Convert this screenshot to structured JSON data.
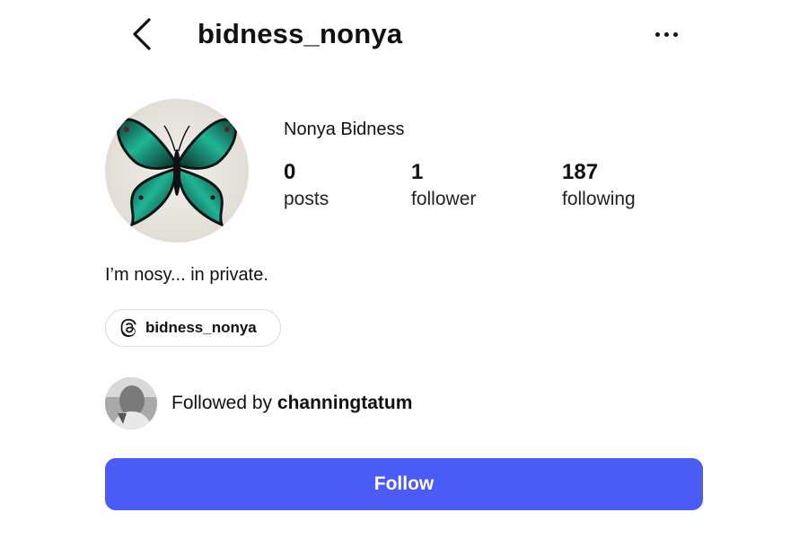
{
  "header": {
    "username": "bidness_nonya",
    "back_icon": "chevron-left-icon",
    "more_icon": "more-horizontal-icon"
  },
  "profile": {
    "display_name": "Nonya Bidness",
    "avatar_icon": "butterfly-avatar",
    "stats": {
      "posts": {
        "value": "0",
        "label": "posts"
      },
      "followers": {
        "value": "1",
        "label": "follower"
      },
      "following": {
        "value": "187",
        "label": "following"
      }
    },
    "bio": "I’m nosy... in private.",
    "threads_link": {
      "icon": "threads-icon",
      "label": "bidness_nonya"
    }
  },
  "followed_by": {
    "prefix": "Followed by ",
    "username": "channingtatum"
  },
  "actions": {
    "follow_label": "Follow",
    "follow_color": "#4a5cf5"
  }
}
